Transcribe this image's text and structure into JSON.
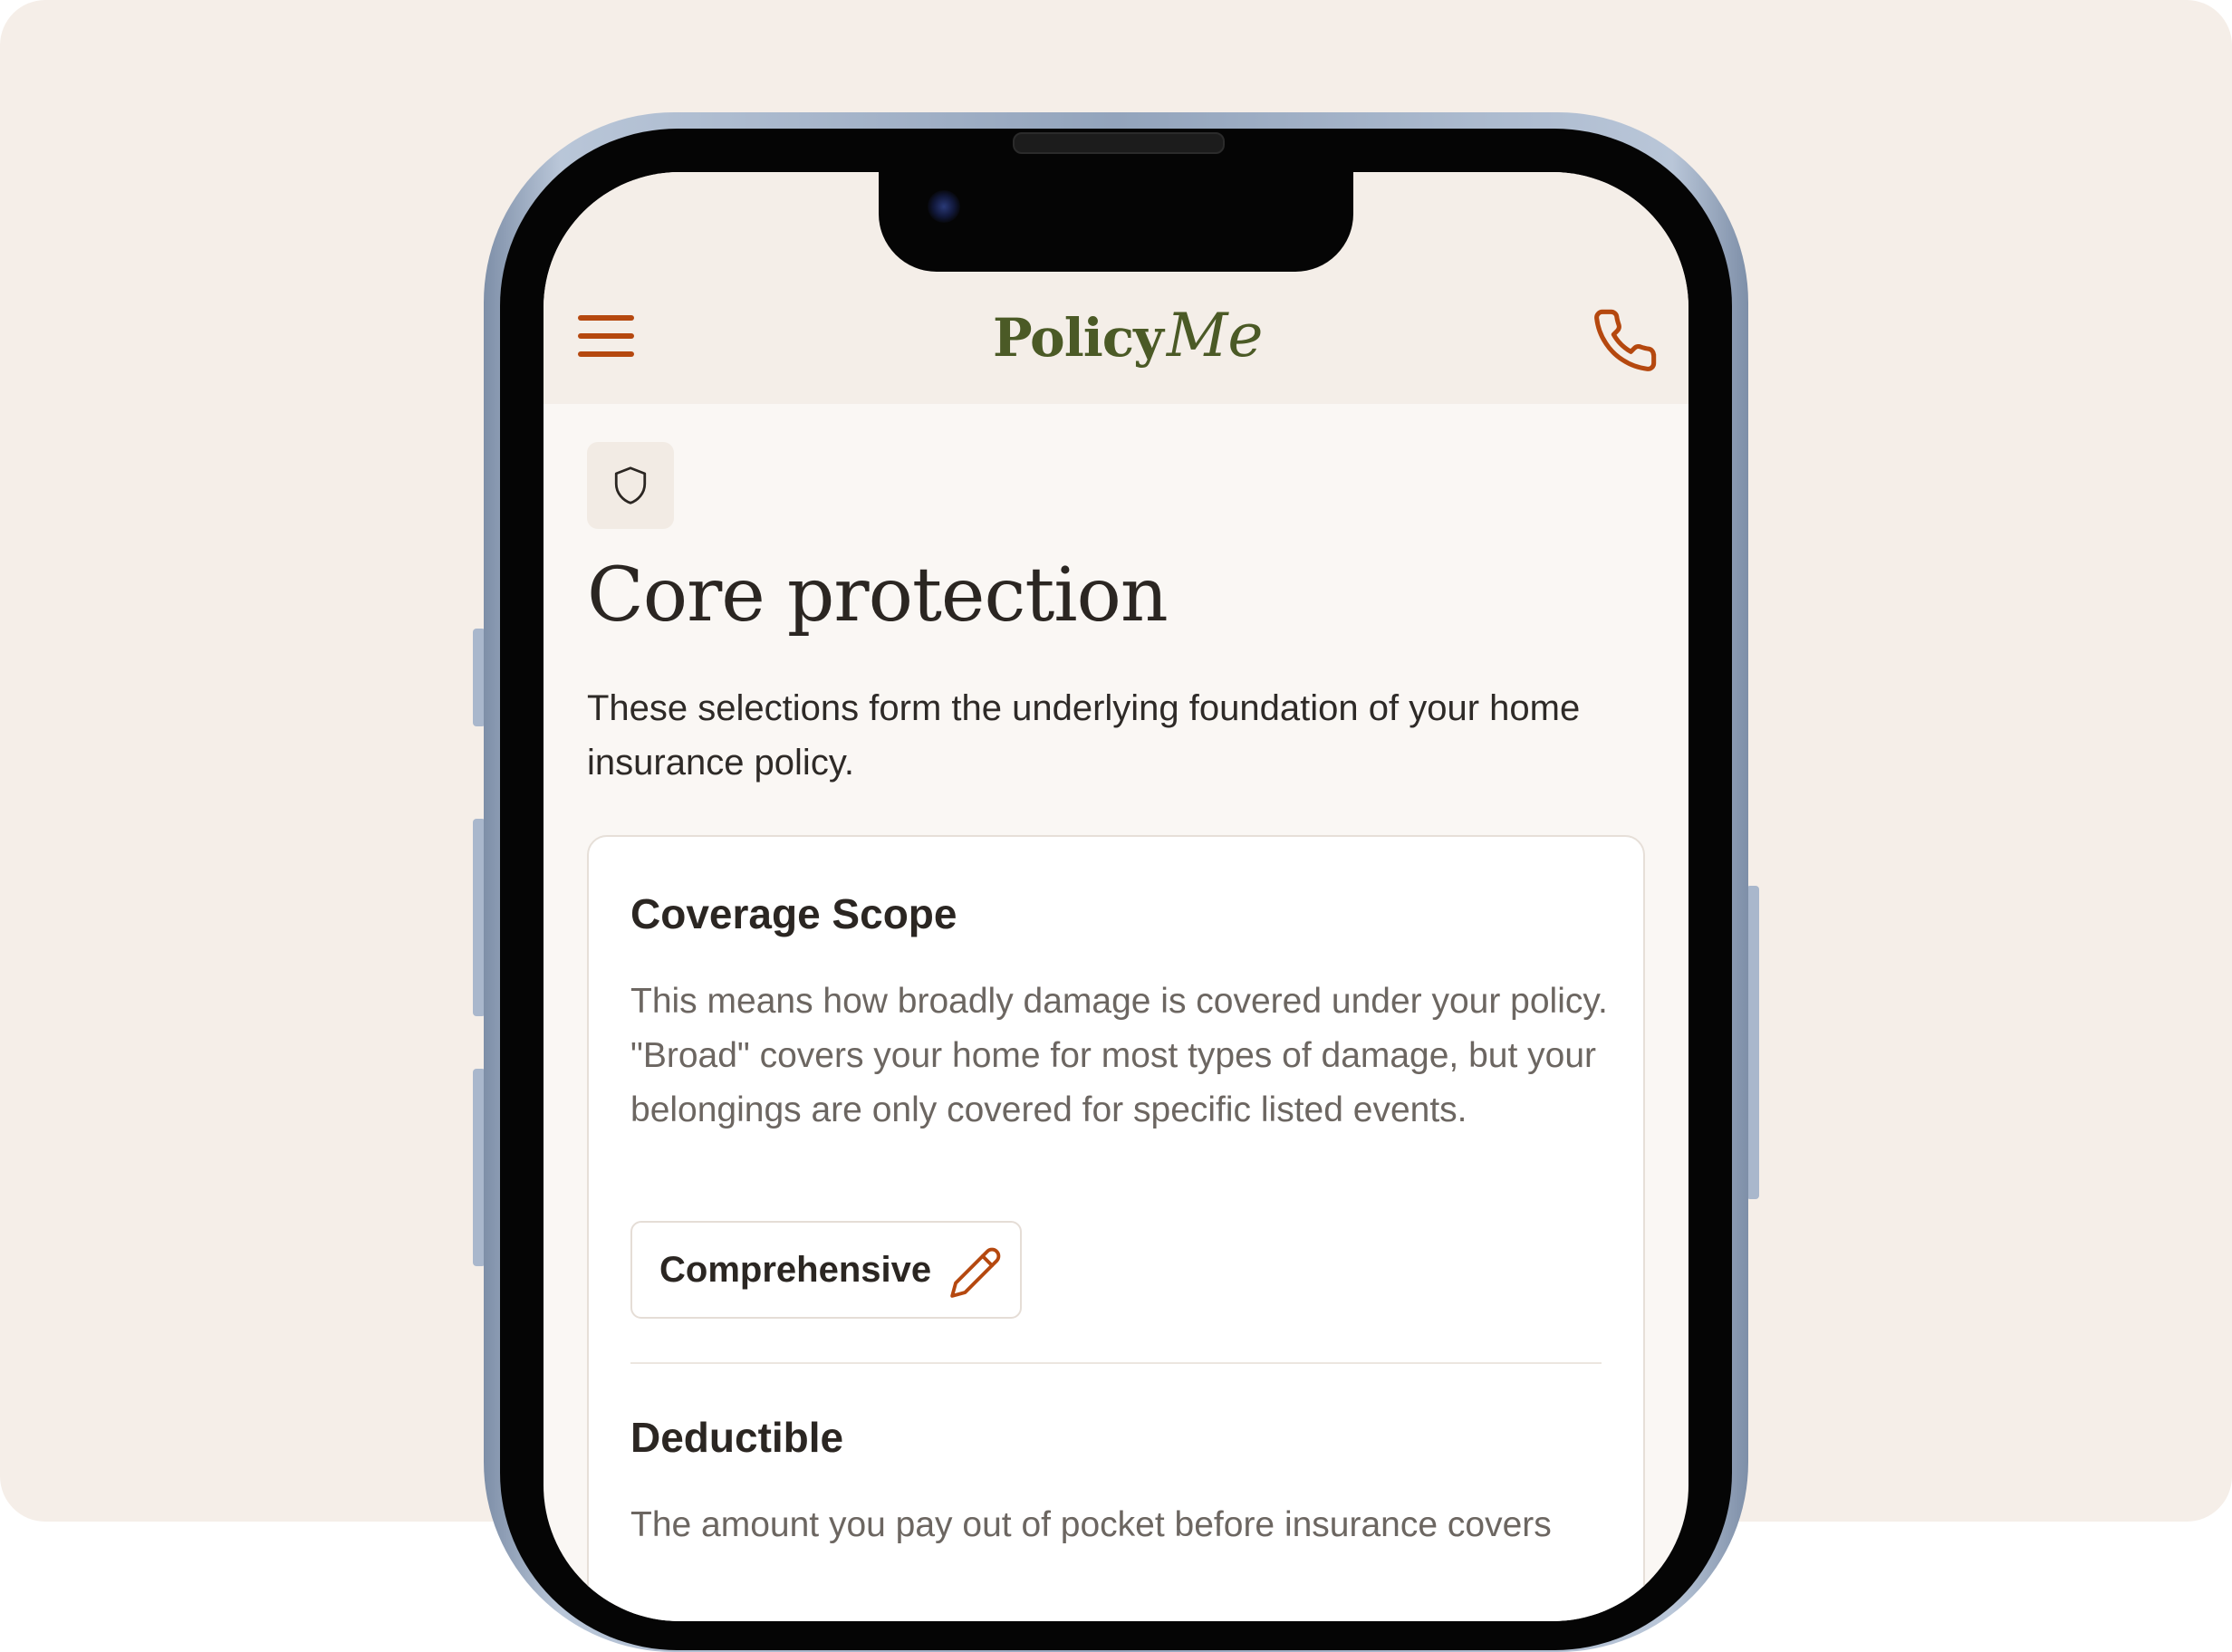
{
  "header": {
    "logo_primary": "Policy",
    "logo_script": "Me",
    "menu_icon": "hamburger-menu-icon",
    "call_icon": "phone-icon"
  },
  "section": {
    "icon": "shield-icon",
    "title": "Core protection",
    "description": "These selections form the underlying foundation of your home insurance policy."
  },
  "coverage_scope": {
    "title": "Coverage Scope",
    "description": "This means how broadly damage is covered under your policy. \"Broad\" covers your home for most types of damage, but your belongings are only covered for specific listed events.",
    "selected_value": "Comprehensive",
    "edit_icon": "pencil-icon"
  },
  "deductible": {
    "title": "Deductible",
    "description": "The amount you pay out of pocket before insurance covers"
  },
  "colors": {
    "accent": "#b5480f",
    "brand": "#4b5a26",
    "background": "#f5eee8",
    "text": "#2b2622"
  }
}
